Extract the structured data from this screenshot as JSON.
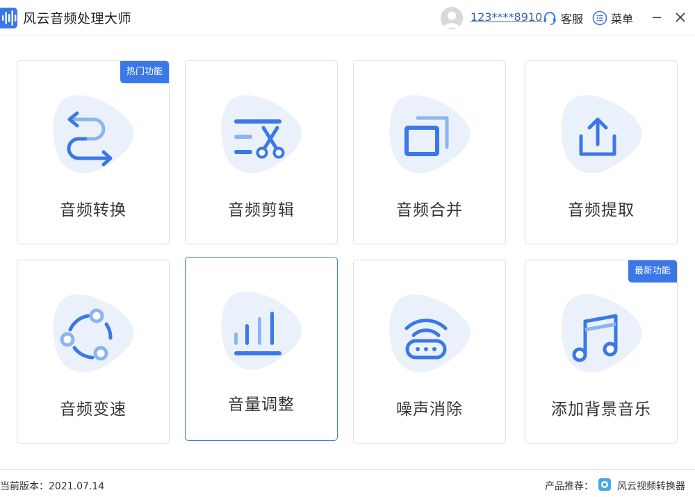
{
  "app": {
    "title": "风云音频处理大师",
    "user_id": "123****8910",
    "support_label": "客服",
    "menu_label": "菜单"
  },
  "features": [
    {
      "label": "音频转换",
      "icon": "convert-arrows-icon",
      "badge": "热门功能"
    },
    {
      "label": "音频剪辑",
      "icon": "scissors-list-icon"
    },
    {
      "label": "音频合并",
      "icon": "merge-squares-icon"
    },
    {
      "label": "音频提取",
      "icon": "upload-tray-icon"
    },
    {
      "label": "音频变速",
      "icon": "speed-circle-icon"
    },
    {
      "label": "音量调整",
      "icon": "volume-bars-icon",
      "selected": true
    },
    {
      "label": "噪声消除",
      "icon": "noise-router-icon"
    },
    {
      "label": "添加背景音乐",
      "icon": "music-note-icon",
      "badge": "最新功能"
    }
  ],
  "status": {
    "version": "当前版本：2021.07.14",
    "recommend_label": "产品推荐：",
    "recommend_product": "风云视频转换器"
  },
  "colors": {
    "accent": "#3b78e7",
    "icon_light": "#8db4f2",
    "blob": "#eaf1fb"
  }
}
